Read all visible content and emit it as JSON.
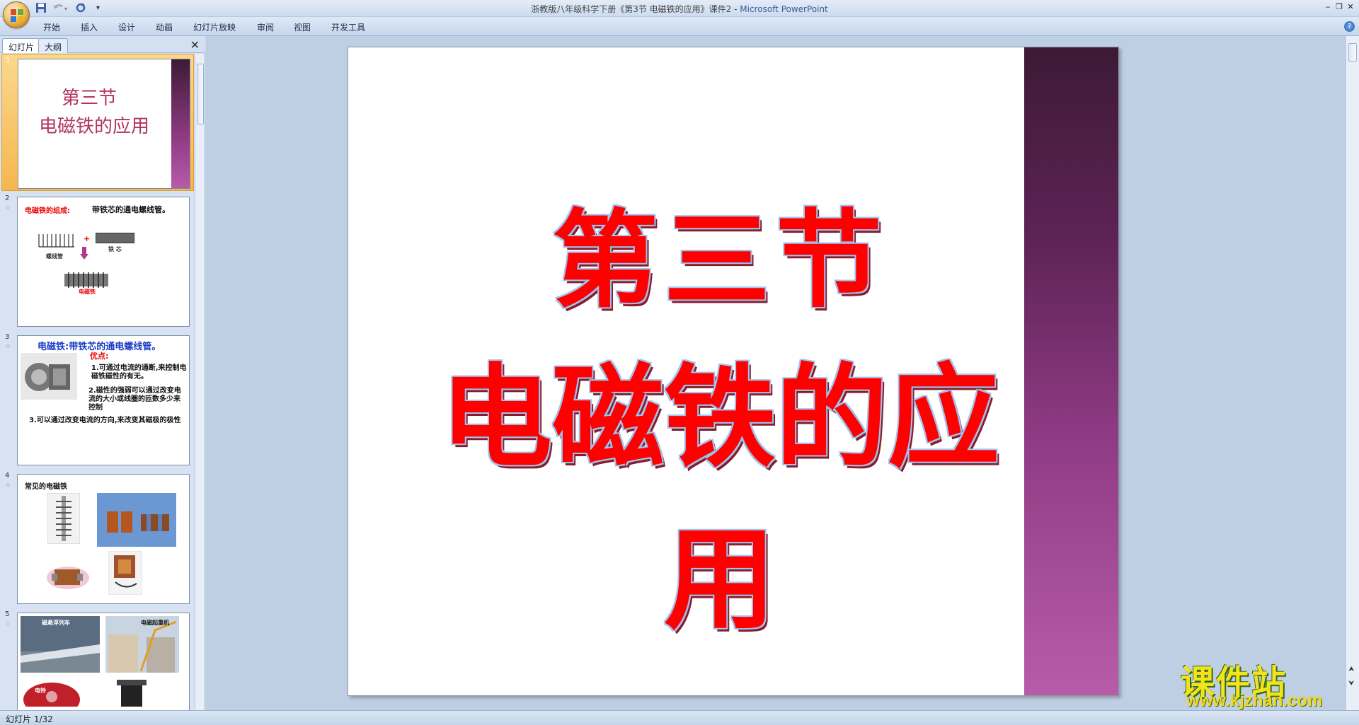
{
  "window": {
    "title_doc": "浙教版八年级科学下册《第3节 电磁铁的应用》课件2 - ",
    "title_app": "Microsoft PowerPoint",
    "min": "‒",
    "max": "❐",
    "close": "✕"
  },
  "qat": {
    "more": "▾"
  },
  "ribbon": {
    "tabs": [
      "开始",
      "插入",
      "设计",
      "动画",
      "幻灯片放映",
      "审阅",
      "视图",
      "开发工具"
    ],
    "help": "?"
  },
  "pane": {
    "tab_slides": "幻灯片",
    "tab_outline": "大纲",
    "close": "✕"
  },
  "thumbnails": [
    {
      "num": "1",
      "line1": "第三节",
      "line2": "电磁铁的应用"
    },
    {
      "num": "2",
      "title_red": "电磁铁的组成:",
      "title_black": "带铁芯的通电螺线管。",
      "plus": "+",
      "lbl_coil": "螺线管",
      "lbl_core": "铁 芯",
      "lbl_magnet": "电磁铁"
    },
    {
      "num": "3",
      "title": "电磁铁:带铁芯的通电螺线管。",
      "adv": "优点:",
      "p1": "1.可通过电流的通断,来控制电磁铁磁性的有无。",
      "p2": "2.磁性的强弱可以通过改变电流的大小或线圈的匝数多少来控制",
      "p3": "3.可以通过改变电流的方向,来改变其磁极的极性"
    },
    {
      "num": "4",
      "title": "常见的电磁铁"
    },
    {
      "num": "5",
      "cap1": "磁悬浮列车",
      "cap2": "电磁起重机",
      "cap3": "电铃"
    }
  ],
  "slide": {
    "line1": "第三节",
    "line2": "电磁铁的应用"
  },
  "watermark": {
    "cn": "课件站",
    "url": "www.kjzhan.com"
  },
  "status": {
    "text": "幻灯片 1/32"
  },
  "colors": {
    "title_red": "#ff0000",
    "band_dark": "#3d1a36",
    "band_light": "#b85ca9",
    "selected_thumb": "#f5b74f"
  }
}
